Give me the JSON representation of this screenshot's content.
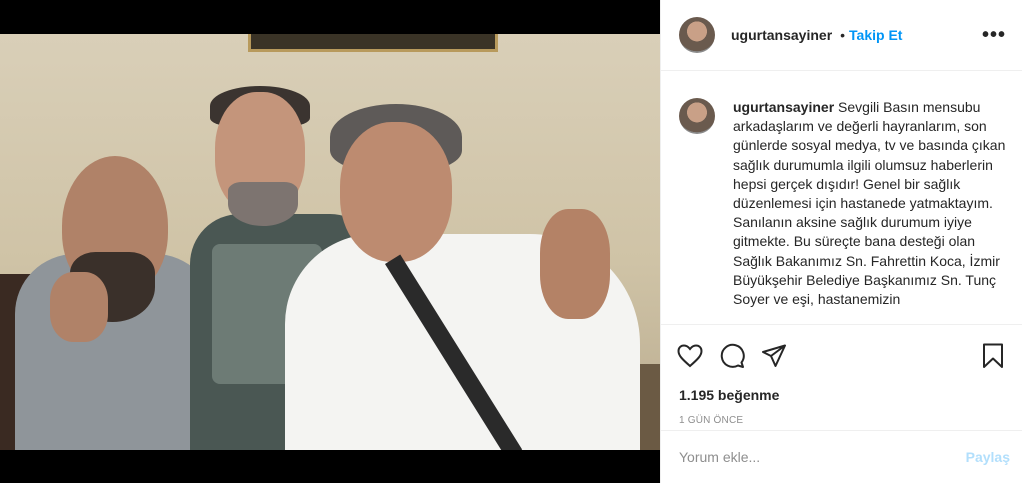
{
  "post": {
    "username": "ugurtansayiner",
    "follow_label": "Takip Et",
    "separator": "•",
    "more_label": "•••"
  },
  "caption": {
    "username": "ugurtansayiner",
    "text": "Sevgili Basın mensubu arkadaşlarım ve değerli hayranlarım, son günlerde sosyal medya, tv ve basında çıkan sağlık durumumla ilgili olumsuz haberlerin hepsi gerçek dışıdır! Genel bir sağlık düzenlemesi için hastanede yatmaktayım. Sanılanın aksine sağlık durumum iyiye gitmekte. Bu süreçte bana desteği olan Sağlık Bakanımız Sn. Fahrettin Koca, İzmir Büyükşehir Belediye Başkanımız Sn. Tunç Soyer ve eşi, hastanemizin"
  },
  "actions": {
    "icons": [
      "heart-icon",
      "comment-icon",
      "share-icon",
      "bookmark-icon"
    ]
  },
  "likes": "1.195 beğenme",
  "timestamp": "1 GÜN ÖNCE",
  "comment": {
    "placeholder": "Yorum ekle...",
    "post_label": "Paylaş"
  },
  "colors": {
    "accent": "#0095f6",
    "muted": "#8e8e8e",
    "post_disabled": "#b2dffc",
    "border": "#efefef"
  }
}
